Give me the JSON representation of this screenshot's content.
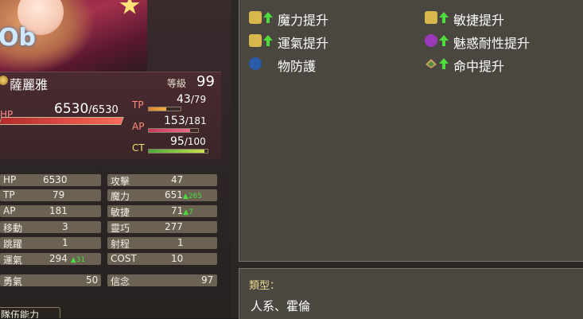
{
  "character": {
    "name": "薩麗雅",
    "level_label": "等級",
    "level": "99",
    "hp_label": "HP",
    "hp_current": "6530",
    "hp_max": "/6530",
    "tp_label": "TP",
    "tp_current": "43",
    "tp_max": "/79",
    "ap_label": "AP",
    "ap_current": "153",
    "ap_max": "/181",
    "ct_label": "CT",
    "ct_current": "95",
    "ct_max": "/100"
  },
  "stats": {
    "left": [
      {
        "key": "HP",
        "value": "6530",
        "bonus": ""
      },
      {
        "key": "TP",
        "value": "79",
        "bonus": ""
      },
      {
        "key": "AP",
        "value": "181",
        "bonus": ""
      },
      {
        "key": "移動",
        "value": "3",
        "bonus": ""
      },
      {
        "key": "跳躍",
        "value": "1",
        "bonus": ""
      },
      {
        "key": "運氣",
        "value": "294",
        "bonus": "31"
      }
    ],
    "right": [
      {
        "key": "攻擊",
        "value": "47",
        "bonus": ""
      },
      {
        "key": "魔力",
        "value": "651",
        "bonus": "265"
      },
      {
        "key": "敏捷",
        "value": "71",
        "bonus": "7"
      },
      {
        "key": "靈巧",
        "value": "277",
        "bonus": ""
      },
      {
        "key": "射程",
        "value": "1",
        "bonus": ""
      },
      {
        "key": "COST",
        "value": "10",
        "bonus": ""
      }
    ],
    "courage_label": "勇氣",
    "courage_value": "50",
    "faith_label": "信念",
    "faith_value": "97"
  },
  "bottom_tab": "隊伍能力",
  "skills": [
    {
      "label": "魔力提升",
      "icon": "magic-up-icon",
      "color": "#d8b84a"
    },
    {
      "label": "運氣提升",
      "icon": "luck-up-icon",
      "color": "#d8b84a"
    },
    {
      "label": "物防護",
      "icon": "physical-guard-icon",
      "color": "#2a5aa8"
    },
    {
      "label": "敏捷提升",
      "icon": "agility-up-icon",
      "color": "#d8b84a"
    },
    {
      "label": "魅惑耐性提升",
      "icon": "charm-resist-icon",
      "color": "#9a3ab8"
    },
    {
      "label": "命中提升",
      "icon": "accuracy-up-icon",
      "color": "#c8a060"
    }
  ],
  "type_info": {
    "label": "類型：",
    "value": "人系、霍倫"
  },
  "fill": {
    "hp": 1.0,
    "tp": 0.544,
    "ap": 0.845,
    "ct": 0.95
  }
}
